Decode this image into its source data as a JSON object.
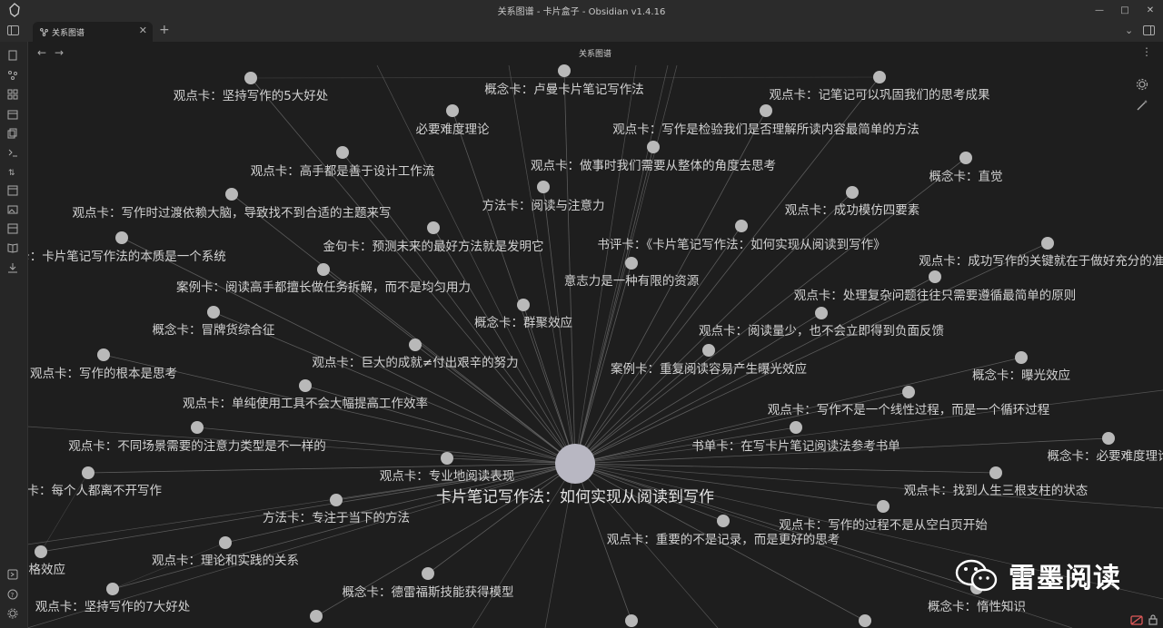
{
  "window": {
    "title": "关系图谱 - 卡片盒子 - Obsidian v1.4.16"
  },
  "tabs": [
    {
      "label": "关系图谱"
    }
  ],
  "view": {
    "title": "关系图谱"
  },
  "graph": {
    "center": {
      "label": "卡片笔记写作法：如何实现从阅读到写作"
    },
    "nodes": [
      {
        "label": "观点卡：坚持写作的5大好处"
      },
      {
        "label": "概念卡：卢曼卡片笔记写作法"
      },
      {
        "label": "观点卡：记笔记可以巩固我们的思考成果"
      },
      {
        "label": "必要难度理论"
      },
      {
        "label": "观点卡：写作是检验我们是否理解所读内容最简单的方法"
      },
      {
        "label": "观点卡：高手都是善于设计工作流"
      },
      {
        "label": "观点卡：做事时我们需要从整体的角度去思考"
      },
      {
        "label": "概念卡：直觉"
      },
      {
        "label": "观点卡：写作时过渡依赖大脑，导致找不到合适的主题来写"
      },
      {
        "label": "方法卡：阅读与注意力"
      },
      {
        "label": "观点卡：成功模仿四要素"
      },
      {
        "label": "卡：卡片笔记写作法的本质是一个系统"
      },
      {
        "label": "金句卡：预测未来的最好方法就是发明它"
      },
      {
        "label": "书评卡：《卡片笔记写作法：如何实现从阅读到写作》"
      },
      {
        "label": "观点卡：成功写作的关键就在于做好充分的准备"
      },
      {
        "label": "案例卡：阅读高手都擅长做任务拆解，而不是均匀用力"
      },
      {
        "label": "意志力是一种有限的资源"
      },
      {
        "label": "观点卡：处理复杂问题往往只需要遵循最简单的原则"
      },
      {
        "label": "概念卡：冒牌货综合征"
      },
      {
        "label": "概念卡：群聚效应"
      },
      {
        "label": "观点卡：阅读量少，也不会立即得到负面反馈"
      },
      {
        "label": "观点卡：写作的根本是思考"
      },
      {
        "label": "观点卡：巨大的成就≠付出艰辛的努力"
      },
      {
        "label": "案例卡：重复阅读容易产生曝光效应"
      },
      {
        "label": "概念卡：曝光效应"
      },
      {
        "label": "观点卡：单纯使用工具不会大幅提高工作效率"
      },
      {
        "label": "观点卡：写作不是一个线性过程，而是一个循环过程"
      },
      {
        "label": "观点卡：不同场景需要的注意力类型是不一样的"
      },
      {
        "label": "书单卡：在写卡片笔记阅读法参考书单"
      },
      {
        "label": "概念卡：必要难度理论"
      },
      {
        "label": "观点卡：专业地阅读表现"
      },
      {
        "label": "点卡：每个人都离不开写作"
      },
      {
        "label": "观点卡：找到人生三根支柱的状态"
      },
      {
        "label": "方法卡：专注于当下的方法"
      },
      {
        "label": "观点卡：写作的过程不是从空白页开始"
      },
      {
        "label": "观点卡：理论和实践的关系"
      },
      {
        "label": "观点卡：重要的不是记录，而是更好的思考"
      },
      {
        "label": "鲁格效应"
      },
      {
        "label": "概念卡：德雷福斯技能获得模型"
      },
      {
        "label": "观点卡：坚持写作的7大好处"
      },
      {
        "label": "概念卡：惰性知识"
      },
      {
        "label": ""
      },
      {
        "label": ""
      },
      {
        "label": ""
      }
    ]
  },
  "watermark": {
    "text": "雷墨阅读",
    "icon": "wechat-icon"
  },
  "colors": {
    "background": "#1e1e1e",
    "node": "#b9b9b9",
    "center_node": "#b8b7c2",
    "link": "#6a6a6a",
    "label": "#d2d2d2"
  }
}
